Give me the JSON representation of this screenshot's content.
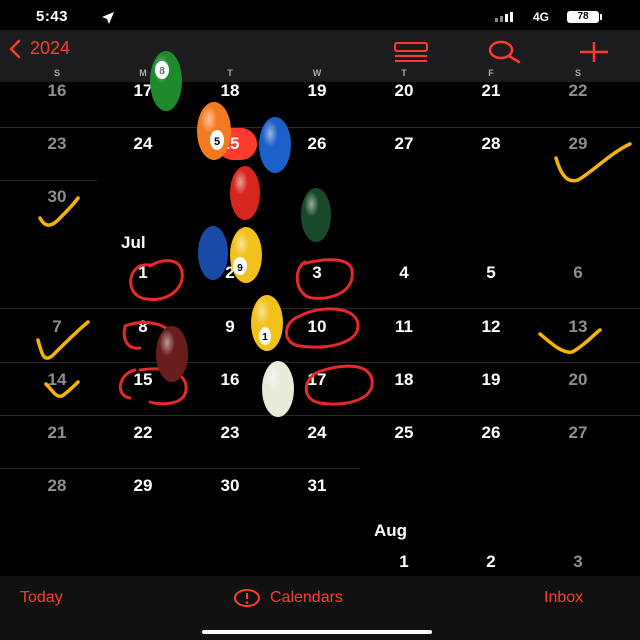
{
  "status_bar": {
    "time": "5:43",
    "network": "4G",
    "battery": "78"
  },
  "nav": {
    "back_label": "2024"
  },
  "weekdays": [
    "S",
    "M",
    "T",
    "W",
    "T",
    "F",
    "S"
  ],
  "june_rows": [
    [
      "16",
      "17",
      "18",
      "19",
      "20",
      "21",
      "22"
    ],
    [
      "23",
      "24",
      "25",
      "26",
      "27",
      "28",
      "29"
    ],
    [
      "30"
    ]
  ],
  "july": {
    "label": "Jul",
    "rows": [
      [
        "",
        "1",
        "2",
        "3",
        "4",
        "5",
        "6"
      ],
      [
        "7",
        "8",
        "9",
        "10",
        "11",
        "12",
        "13"
      ],
      [
        "14",
        "15",
        "16",
        "17",
        "18",
        "19",
        "20"
      ],
      [
        "21",
        "22",
        "23",
        "24",
        "25",
        "26",
        "27"
      ],
      [
        "28",
        "29",
        "30",
        "31"
      ]
    ]
  },
  "august": {
    "label": "Aug",
    "rows": [
      [
        "",
        "",
        "",
        "",
        "1",
        "2",
        "3"
      ]
    ]
  },
  "toolbar": {
    "today_label": "Today",
    "calendars_label": "Calendars",
    "inbox_label": "Inbox"
  },
  "colors": {
    "accent": "#ff3b30",
    "background": "#000000",
    "annotation_yellow": "#f5b400"
  },
  "icons": [
    "location-arrow-icon",
    "list-view-icon",
    "search-icon",
    "add-icon",
    "alert-circle-icon",
    "chevron-left-icon"
  ],
  "stickers": [
    "billiard-ball-8",
    "billiard-ball-5",
    "billiard-ball-blue",
    "billiard-ball-red",
    "billiard-ball-green",
    "billiard-ball-9",
    "billiard-ball-1",
    "billiard-ball-7",
    "billiard-ball-cue"
  ]
}
